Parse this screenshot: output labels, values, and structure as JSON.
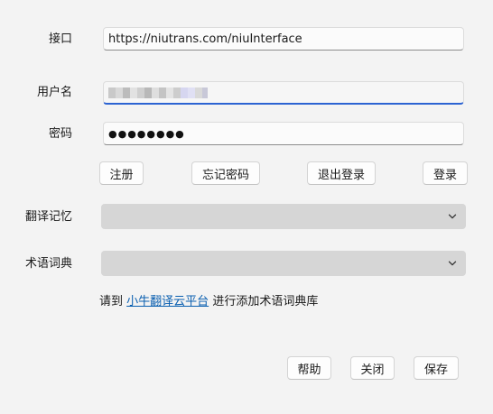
{
  "form": {
    "interface_label": "接口",
    "interface_value": "https://niutrans.com/niuInterface",
    "username_label": "用户名",
    "username_value": "",
    "password_label": "密码",
    "password_value": "●●●●●●●●",
    "memory_label": "翻译记忆",
    "memory_value": "",
    "termbase_label": "术语词典",
    "termbase_value": ""
  },
  "account_buttons": {
    "register": "注册",
    "forgot_password": "忘记密码",
    "logout": "退出登录",
    "login": "登录"
  },
  "hint": {
    "prefix": "请到",
    "link": "小牛翻译云平台",
    "suffix": "进行添加术语词典库"
  },
  "footer_buttons": {
    "help": "帮助",
    "close": "关闭",
    "save": "保存"
  },
  "icons": {
    "dropdown": "chevron-down-icon"
  },
  "colors": {
    "background": "#f3f3f3",
    "focus_accent": "#2c63d2",
    "link": "#0a5fb0",
    "combo_disabled": "#d6d6d6"
  }
}
